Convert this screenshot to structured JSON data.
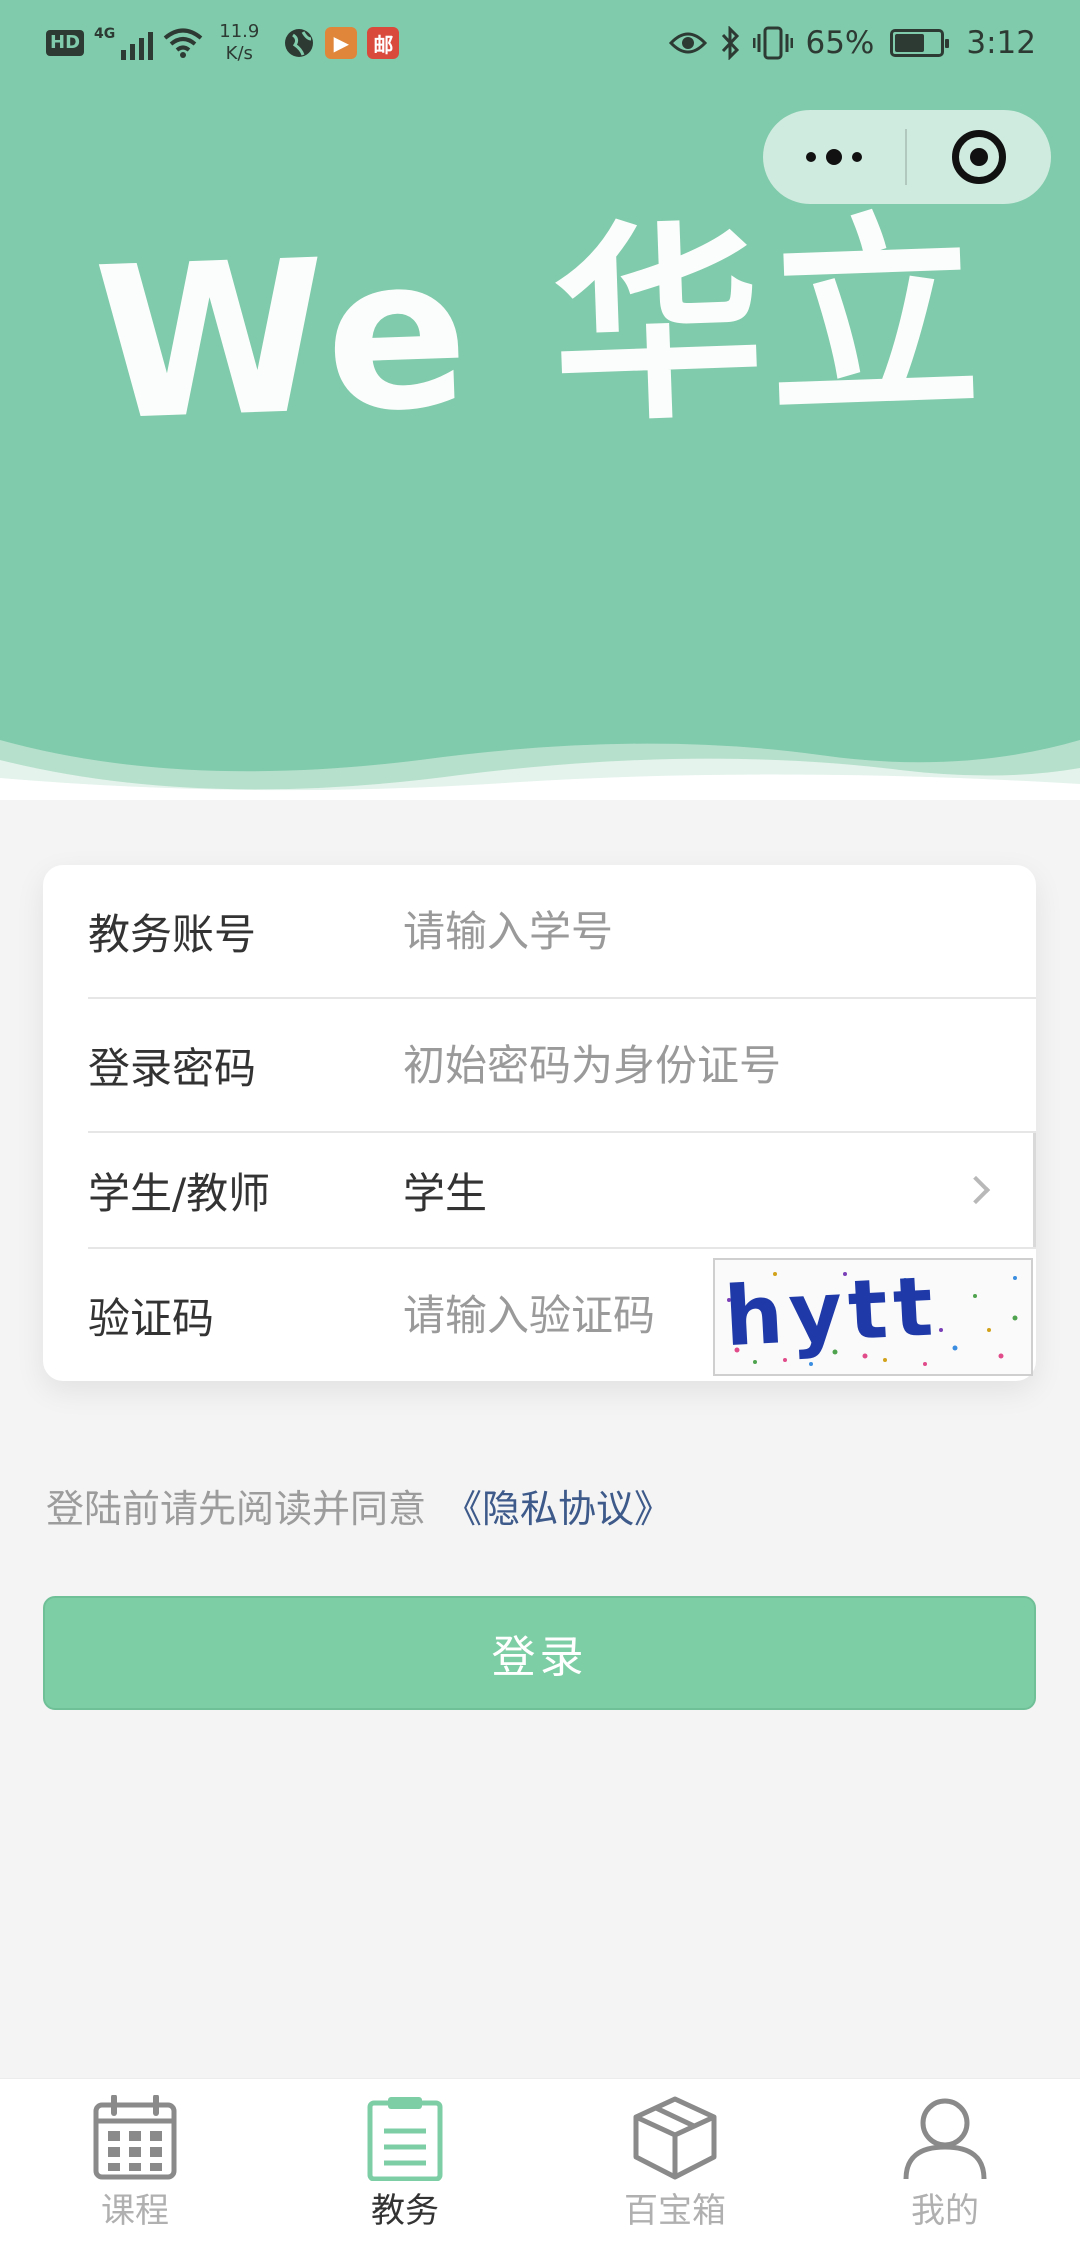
{
  "status_bar": {
    "hd_label": "HD",
    "network_label": "4G",
    "speed_value": "11.9",
    "speed_unit": "K/s",
    "app_badge_1_label": "▶",
    "app_badge_2_label": "邮",
    "battery_percent": "65%",
    "battery_level": 0.65,
    "time": "3:12"
  },
  "header": {
    "logo_text": "We 华立",
    "background_color": "#80cbab"
  },
  "form": {
    "account": {
      "label": "教务账号",
      "placeholder": "请输入学号"
    },
    "password": {
      "label": "登录密码",
      "placeholder": "初始密码为身份证号"
    },
    "role": {
      "label": "学生/教师",
      "value": "学生"
    },
    "captcha": {
      "label": "验证码",
      "placeholder": "请输入验证码",
      "image_text": "hytt"
    }
  },
  "agreement": {
    "text": "登陆前请先阅读并同意",
    "link": "《隐私协议》"
  },
  "login_button": {
    "label": "登录",
    "color": "#7ecea5"
  },
  "tabbar": {
    "tabs": [
      {
        "label": "课程",
        "icon": "calendar-icon",
        "active": false
      },
      {
        "label": "教务",
        "icon": "clipboard-icon",
        "active": true
      },
      {
        "label": "百宝箱",
        "icon": "box-icon",
        "active": false
      },
      {
        "label": "我的",
        "icon": "user-icon",
        "active": false
      }
    ],
    "active_color": "#7ecea5"
  }
}
